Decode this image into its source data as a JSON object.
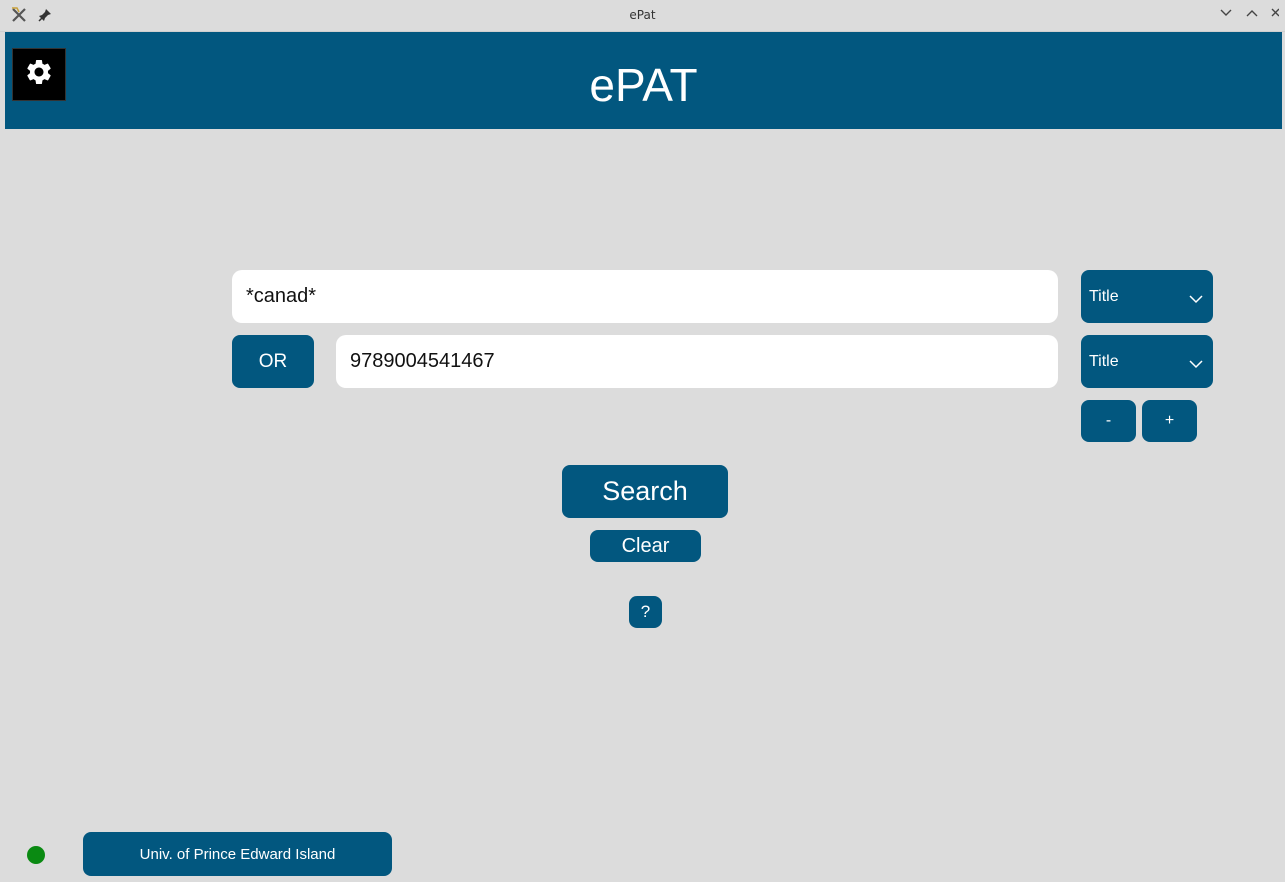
{
  "window": {
    "title": "ePat"
  },
  "header": {
    "title": "ePAT"
  },
  "search": {
    "row1": {
      "value": "*canad*",
      "field": "Title"
    },
    "row2": {
      "operator": "OR",
      "value": "9789004541467",
      "field": "Title"
    },
    "remove_row_label": "-",
    "add_row_label": "+",
    "search_label": "Search",
    "clear_label": "Clear",
    "help_label": "?"
  },
  "footer": {
    "status_color": "#0a8a12",
    "institution_label": "Univ. of Prince Edward Island"
  },
  "colors": {
    "accent": "#02577f",
    "background": "#dcdcdc"
  },
  "icons": {
    "app": "app-x-icon",
    "pin": "pin-icon",
    "settings": "gear-icon",
    "dropdown": "chevron-down-icon",
    "minimize": "chevron-down-icon",
    "maximize": "chevron-up-icon",
    "close": "close-icon"
  }
}
